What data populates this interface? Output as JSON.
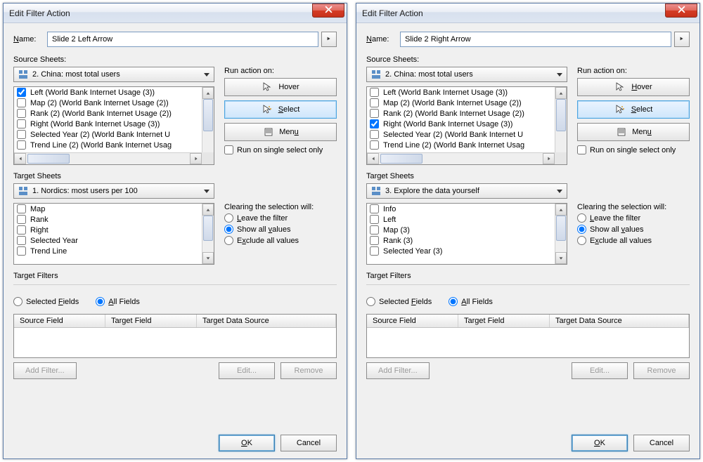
{
  "dialogs": [
    {
      "title": "Edit Filter Action",
      "name_label": "Name:",
      "name_value": "Slide 2 Left Arrow",
      "source_label": "Source Sheets:",
      "source_dropdown": "2. China: most total users",
      "source_items": [
        {
          "label": "Left (World Bank Internet Usage (3))",
          "checked": true
        },
        {
          "label": "Map (2) (World Bank Internet Usage (2))",
          "checked": false
        },
        {
          "label": "Rank (2) (World Bank Internet Usage (2))",
          "checked": false
        },
        {
          "label": "Right (World Bank Internet Usage (3))",
          "checked": false
        },
        {
          "label": "Selected Year (2) (World Bank Internet U",
          "checked": false
        },
        {
          "label": "Trend Line (2) (World Bank Internet Usag",
          "checked": false
        }
      ],
      "run_label": "Run action on:",
      "hover": "Hover",
      "select": "Select",
      "menu": "Menu",
      "run_single": "Run on single select only",
      "target_label": "Target Sheets",
      "target_dropdown": "1. Nordics: most users per 100",
      "target_items": [
        {
          "label": "Map",
          "checked": false
        },
        {
          "label": "Rank",
          "checked": false
        },
        {
          "label": "Right",
          "checked": false
        },
        {
          "label": "Selected Year",
          "checked": false
        },
        {
          "label": "Trend Line",
          "checked": false
        }
      ],
      "clear_label": "Clearing the selection will:",
      "leave": "Leave the filter",
      "show_all": "Show all values",
      "exclude": "Exclude all values",
      "target_filters_label": "Target Filters",
      "selected_fields": "Selected Fields",
      "all_fields": "All Fields",
      "col_source": "Source Field",
      "col_target": "Target Field",
      "col_ds": "Target Data Source",
      "add_filter": "Add Filter...",
      "edit": "Edit...",
      "remove": "Remove",
      "ok": "OK",
      "cancel": "Cancel"
    },
    {
      "title": "Edit Filter Action",
      "name_label": "Name:",
      "name_value": "Slide 2 Right Arrow",
      "source_label": "Source Sheets:",
      "source_dropdown": "2. China: most total users",
      "source_items": [
        {
          "label": "Left (World Bank Internet Usage (3))",
          "checked": false
        },
        {
          "label": "Map (2) (World Bank Internet Usage (2))",
          "checked": false
        },
        {
          "label": "Rank (2) (World Bank Internet Usage (2))",
          "checked": false
        },
        {
          "label": "Right (World Bank Internet Usage (3))",
          "checked": true
        },
        {
          "label": "Selected Year (2) (World Bank Internet U",
          "checked": false
        },
        {
          "label": "Trend Line (2) (World Bank Internet Usag",
          "checked": false
        }
      ],
      "run_label": "Run action on:",
      "hover": "Hover",
      "select": "Select",
      "menu": "Menu",
      "run_single": "Run on single select only",
      "target_label": "Target Sheets",
      "target_dropdown": "3. Explore the data yourself",
      "target_items": [
        {
          "label": "Info",
          "checked": false
        },
        {
          "label": "Left",
          "checked": false
        },
        {
          "label": "Map (3)",
          "checked": false
        },
        {
          "label": "Rank (3)",
          "checked": false
        },
        {
          "label": "Selected Year (3)",
          "checked": false
        }
      ],
      "clear_label": "Clearing the selection will:",
      "leave": "Leave the filter",
      "show_all": "Show all values",
      "exclude": "Exclude all values",
      "target_filters_label": "Target Filters",
      "selected_fields": "Selected Fields",
      "all_fields": "All Fields",
      "col_source": "Source Field",
      "col_target": "Target Field",
      "col_ds": "Target Data Source",
      "add_filter": "Add Filter...",
      "edit": "Edit...",
      "remove": "Remove",
      "ok": "OK",
      "cancel": "Cancel"
    }
  ]
}
